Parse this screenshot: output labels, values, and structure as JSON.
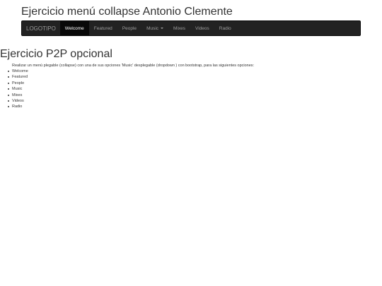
{
  "header": {
    "title": "Ejercicio menú collapse Antonio Clemente"
  },
  "navbar": {
    "brand": "LOGOTIPO",
    "items": [
      {
        "label": "Welcome",
        "active": true
      },
      {
        "label": "Featured"
      },
      {
        "label": "People"
      },
      {
        "label": "Music",
        "dropdown": true
      },
      {
        "label": "Mixes"
      },
      {
        "label": "Videos"
      },
      {
        "label": "Radio"
      }
    ]
  },
  "main": {
    "title": "Ejercicio P2P opcional",
    "description": "Realizar un menú plegable (collapse) con una de sus opciones 'Music' desplegable (dropdown ) con bootstrap, para las siguientes opciones:",
    "options": [
      "Welcome",
      "Featured",
      "People",
      "Music",
      "Mixes",
      "Videos",
      "Radio"
    ]
  },
  "colors": {
    "navbar_bg": "#222222",
    "navbar_active_bg": "#080808",
    "navbar_text": "#9d9d9d",
    "navbar_active_text": "#ffffff",
    "body_text": "#333333"
  }
}
